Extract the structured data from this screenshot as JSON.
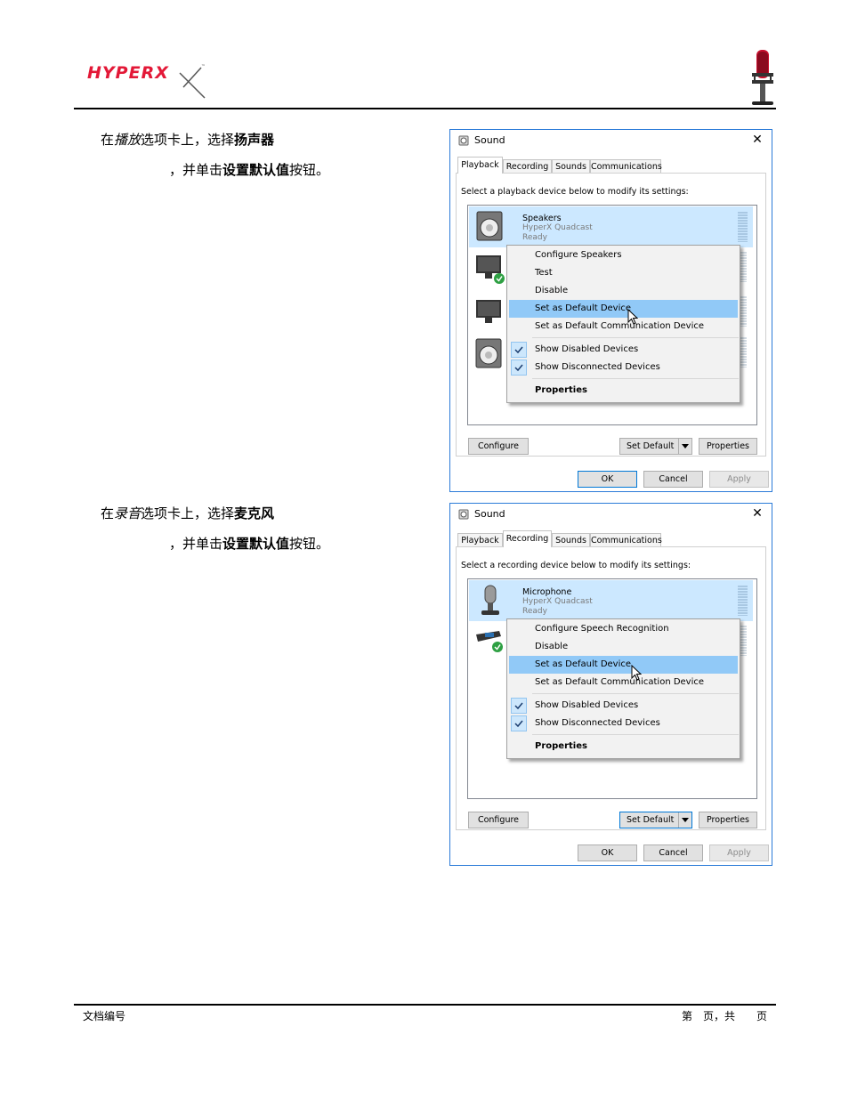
{
  "header": {
    "logo_icon": "hyperx-logo",
    "logo_text": "HYPERX",
    "brand_color": "#e31837",
    "mic_icon": "quadcast-microphone-icon"
  },
  "section1": {
    "line1_prefix": "在",
    "line1_tab": "播放",
    "line1_mid": "选项卡上，选择",
    "line1_device": "扬声器",
    "line2_prefix": "，并单击",
    "line2_button": "设置默认值",
    "line2_suffix": "按钮。"
  },
  "section2": {
    "line1_prefix": "在",
    "line1_tab": "录音",
    "line1_mid": "选项卡上，选择",
    "line1_device": "麦克风",
    "line2_prefix": "，并单击",
    "line2_button": "设置默认值",
    "line2_suffix": "按钮。"
  },
  "dialog_playback": {
    "title": "Sound",
    "tabs": [
      "Playback",
      "Recording",
      "Sounds",
      "Communications"
    ],
    "active_tab": "Playback",
    "prompt": "Select a playback device below to modify its settings:",
    "selected_device": {
      "name": "Speakers",
      "sub1": "HyperX Quadcast",
      "sub2": "Ready"
    },
    "menu": {
      "configure": "Configure Speakers",
      "test": "Test",
      "disable": "Disable",
      "set_default": "Set as Default Device",
      "set_comm": "Set as Default Communication Device",
      "show_disabled": "Show Disabled Devices",
      "show_disconnected": "Show Disconnected Devices",
      "properties": "Properties"
    },
    "buttons": {
      "configure": "Configure",
      "set_default": "Set Default",
      "properties": "Properties",
      "ok": "OK",
      "cancel": "Cancel",
      "apply": "Apply"
    }
  },
  "dialog_recording": {
    "title": "Sound",
    "tabs": [
      "Playback",
      "Recording",
      "Sounds",
      "Communications"
    ],
    "active_tab": "Recording",
    "prompt": "Select a recording device below to modify its settings:",
    "selected_device": {
      "name": "Microphone",
      "sub1": "HyperX Quadcast",
      "sub2": "Ready"
    },
    "menu": {
      "configure": "Configure Speech Recognition",
      "disable": "Disable",
      "set_default": "Set as Default Device",
      "set_comm": "Set as Default Communication Device",
      "show_disabled": "Show Disabled Devices",
      "show_disconnected": "Show Disconnected Devices",
      "properties": "Properties"
    },
    "buttons": {
      "configure": "Configure",
      "set_default": "Set Default",
      "properties": "Properties",
      "ok": "OK",
      "cancel": "Cancel",
      "apply": "Apply"
    }
  },
  "footer": {
    "doc_number": "文档编号",
    "page_label": "第　页，共　　页"
  }
}
